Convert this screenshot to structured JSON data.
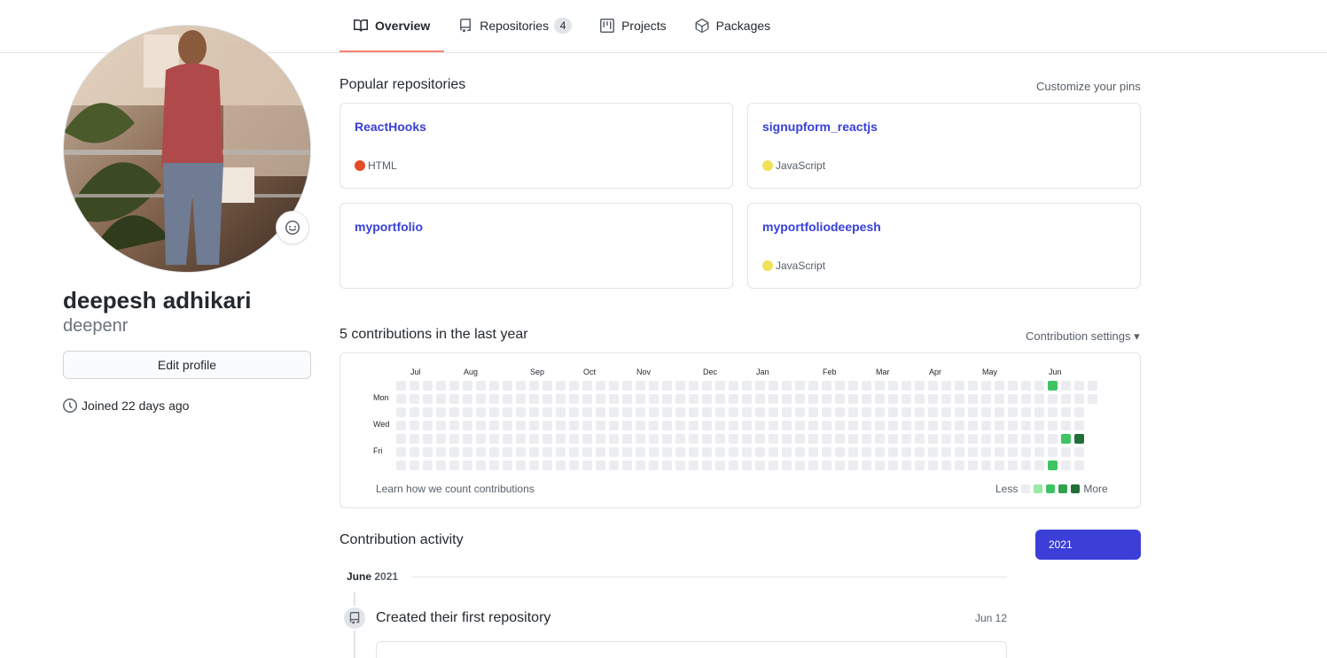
{
  "tabs": [
    {
      "label": "Overview",
      "icon": "book-icon",
      "active": true
    },
    {
      "label": "Repositories",
      "icon": "repo-icon",
      "counter": "4"
    },
    {
      "label": "Projects",
      "icon": "project-icon"
    },
    {
      "label": "Packages",
      "icon": "package-icon"
    }
  ],
  "profile": {
    "fullname": "deepesh adhikari",
    "username": "deepenr",
    "edit_label": "Edit profile",
    "joined": "Joined 22 days ago"
  },
  "popular": {
    "title": "Popular repositories",
    "customize": "Customize your pins",
    "repos": [
      {
        "name": "ReactHooks",
        "language": "HTML",
        "color": "#e34c26"
      },
      {
        "name": "signupform_reactjs",
        "language": "JavaScript",
        "color": "#f1e05a"
      },
      {
        "name": "myportfolio",
        "language": "",
        "color": ""
      },
      {
        "name": "myportfoliodeepesh",
        "language": "JavaScript",
        "color": "#f1e05a"
      }
    ]
  },
  "contributions": {
    "title": "5 contributions in the last year",
    "settings": "Contribution settings ▾",
    "months": [
      "Jul",
      "Aug",
      "Sep",
      "Oct",
      "Nov",
      "Dec",
      "Jan",
      "Feb",
      "Mar",
      "Apr",
      "May",
      "Jun"
    ],
    "days": [
      "Mon",
      "Wed",
      "Fri"
    ],
    "learn": "Learn how we count contributions",
    "less": "Less",
    "more": "More",
    "colors": {
      "empty": "#ebedf0",
      "l1": "#9be9a8",
      "l2": "#40c463",
      "l3": "#30a14e",
      "l4": "#216e39"
    },
    "active_cells": [
      {
        "week": 49,
        "day": 0,
        "level": "l2"
      },
      {
        "week": 49,
        "day": 6,
        "level": "l2"
      },
      {
        "week": 50,
        "day": 4,
        "level": "l2"
      },
      {
        "week": 51,
        "day": 4,
        "level": "l4"
      }
    ]
  },
  "activity": {
    "title": "Contribution activity",
    "year": "2021",
    "month": "June",
    "month_year": "2021",
    "event": "Created their first repository",
    "date": "Jun 12"
  }
}
